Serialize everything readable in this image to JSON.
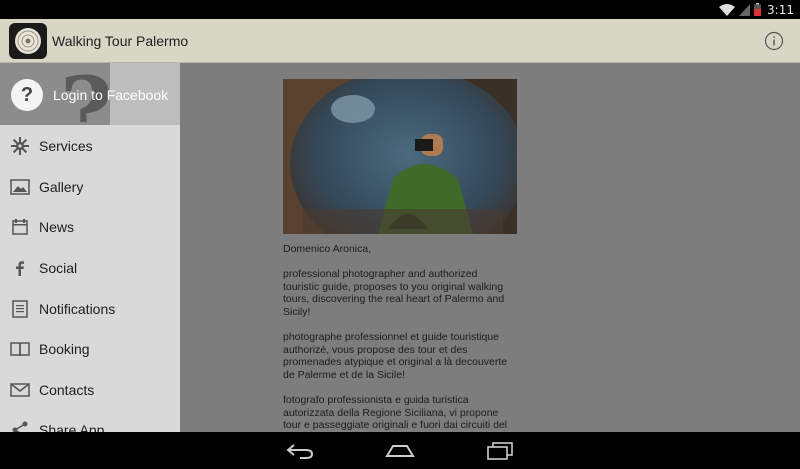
{
  "status_bar": {
    "clock": "3:11"
  },
  "action_bar": {
    "title": "Walking Tour Palermo"
  },
  "drawer": {
    "login_label": "Login to Facebook",
    "items": [
      {
        "label": "Services",
        "icon": "gear-icon"
      },
      {
        "label": "Gallery",
        "icon": "image-icon"
      },
      {
        "label": "News",
        "icon": "calendar-icon"
      },
      {
        "label": "Social",
        "icon": "facebook-icon"
      },
      {
        "label": "Notifications",
        "icon": "document-icon"
      },
      {
        "label": "Booking",
        "icon": "book-icon"
      },
      {
        "label": "Contacts",
        "icon": "envelope-icon"
      },
      {
        "label": "Share App",
        "icon": "share-icon"
      }
    ]
  },
  "article": {
    "author": "Domenico Aronica,",
    "p_en": "professional photographer and authorized touristic guide, proposes to you original walking tours, discovering the real heart of Palermo and Sicily!",
    "p_fr": "photographe professionnel et guide touristique authorizé, vous propose des tour et des promenades atypique et original a là decouverte de Palerme et de la Sicile!",
    "p_it": "fotografo professionista e guida turistica autorizzata della Regione Siciliana, vi propone tour e passeggiate originali e fuori dai circuiti del"
  },
  "colors": {
    "action_bar": "#d8d7c6",
    "drawer": "#d9d9d9",
    "scrim": "#7d7d7d"
  }
}
